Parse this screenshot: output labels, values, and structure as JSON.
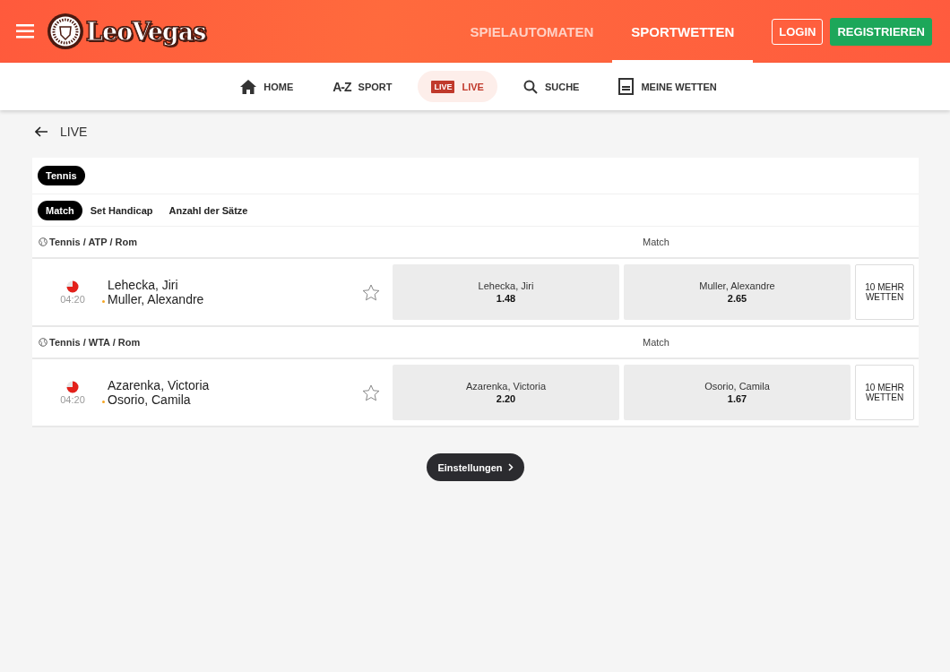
{
  "header": {
    "logo_text": "LeoVegas",
    "nav": [
      {
        "label": "SPIELAUTOMATEN",
        "selected": false
      },
      {
        "label": "SPORTWETTEN",
        "selected": true
      }
    ],
    "login": "LOGIN",
    "register": "REGISTRIEREN"
  },
  "subnav": [
    {
      "kind": "home",
      "label": "HOME",
      "selected": false
    },
    {
      "kind": "az",
      "icon_text": "A-Z",
      "label": "SPORT",
      "selected": false
    },
    {
      "kind": "live",
      "icon_text": "LIVE",
      "label": "LIVE",
      "selected": true
    },
    {
      "kind": "search",
      "label": "SUCHE",
      "selected": false
    },
    {
      "kind": "betslip",
      "label": "MEINE WETTEN",
      "selected": false
    }
  ],
  "page_title": "LIVE",
  "sports": [
    {
      "label": "Tennis",
      "selected": true
    }
  ],
  "markets": [
    {
      "label": "Match",
      "selected": true
    },
    {
      "label": "Set Handicap",
      "selected": false
    },
    {
      "label": "Anzahl der Sätze",
      "selected": false
    }
  ],
  "leagues": [
    {
      "title": "Tennis / ATP / Rom",
      "market": "Match",
      "matches": [
        {
          "time": "04:20",
          "players": [
            {
              "name": "Lehecka, Jiri",
              "serving": false
            },
            {
              "name": "Muller, Alexandre",
              "serving": true
            }
          ],
          "favorite": false,
          "odds": [
            {
              "name": "Lehecka, Jiri",
              "price": "1.48"
            },
            {
              "name": "Muller, Alexandre",
              "price": "2.65"
            }
          ],
          "more": "10 MEHR WETTEN"
        }
      ]
    },
    {
      "title": "Tennis / WTA / Rom",
      "market": "Match",
      "matches": [
        {
          "time": "04:20",
          "players": [
            {
              "name": "Azarenka, Victoria",
              "serving": false
            },
            {
              "name": "Osorio, Camila",
              "serving": true
            }
          ],
          "favorite": false,
          "odds": [
            {
              "name": "Azarenka, Victoria",
              "price": "2.20"
            },
            {
              "name": "Osorio, Camila",
              "price": "1.67"
            }
          ],
          "more": "10 MEHR WETTEN"
        }
      ]
    }
  ],
  "settings_button": "Einstellungen"
}
